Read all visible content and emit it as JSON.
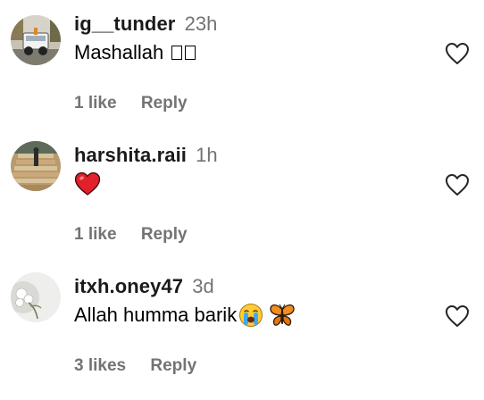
{
  "comments": [
    {
      "username": "ig__tunder",
      "time": "23h",
      "text": "Mashallah",
      "text_suffix": "broken-glyph-boxes",
      "likes": "1 like",
      "reply_label": "Reply",
      "avatar_icon": "jeep-photo-avatar",
      "like_icon": "heart-outline-icon"
    },
    {
      "username": "harshita.raii",
      "time": "1h",
      "text": "",
      "text_emoji": "red-heart-emoji",
      "likes": "1 like",
      "reply_label": "Reply",
      "avatar_icon": "staircase-photo-avatar",
      "like_icon": "heart-outline-icon"
    },
    {
      "username": "itxh.oney47",
      "time": "3d",
      "text": "Allah humma barik",
      "text_emoji": [
        "crying-face-emoji",
        "butterfly-emoji"
      ],
      "likes": "3 likes",
      "reply_label": "Reply",
      "avatar_icon": "white-flowers-avatar",
      "like_icon": "heart-outline-icon"
    }
  ],
  "colors": {
    "username": "#1a1a1a",
    "secondary_text": "#737373",
    "heart_emoji": "#e0202b",
    "icon_stroke": "#262626"
  }
}
